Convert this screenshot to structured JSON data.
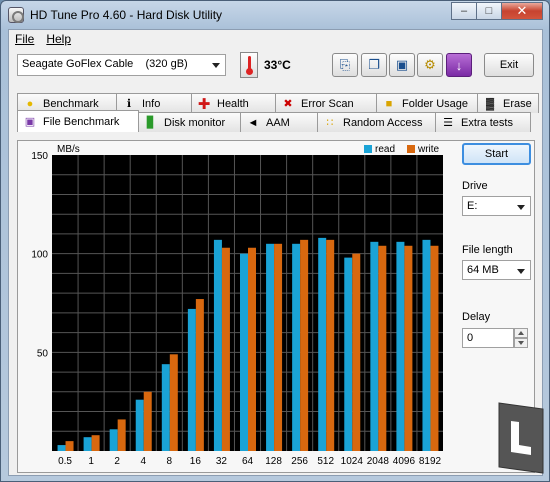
{
  "window": {
    "title": "HD Tune Pro 4.60 - Hard Disk Utility"
  },
  "menu": [
    {
      "label": "File"
    },
    {
      "label": "Help"
    }
  ],
  "toolbar": {
    "drive_selected": "Seagate GoFlex Cable    (320 gB)",
    "temperature": "33°C",
    "exit_label": "Exit"
  },
  "tabs_top": [
    {
      "label": "Benchmark",
      "icon": "lightbulb-icon"
    },
    {
      "label": "Info",
      "icon": "info-icon"
    },
    {
      "label": "Health",
      "icon": "health-cross-icon"
    },
    {
      "label": "Error Scan",
      "icon": "error-scan-icon"
    },
    {
      "label": "Folder Usage",
      "icon": "folder-icon"
    },
    {
      "label": "Erase",
      "icon": "trash-icon"
    }
  ],
  "tabs_bottom": [
    {
      "label": "File Benchmark",
      "icon": "file-benchmark-icon",
      "active": true
    },
    {
      "label": "Disk monitor",
      "icon": "disk-monitor-icon"
    },
    {
      "label": "AAM",
      "icon": "speaker-icon"
    },
    {
      "label": "Random Access",
      "icon": "random-access-icon"
    },
    {
      "label": "Extra tests",
      "icon": "extra-tests-icon"
    }
  ],
  "side": {
    "start_label": "Start",
    "drive_label": "Drive",
    "drive_value": "E:",
    "file_length_label": "File length",
    "file_length_value": "64 MB",
    "delay_label": "Delay",
    "delay_value": "0"
  },
  "colors": {
    "read": "#1aa3d6",
    "write": "#d8680f",
    "grid": "#555555",
    "plot_bg": "#000000"
  },
  "chart_data": {
    "type": "bar",
    "ylabel": "MB/s",
    "ylim": [
      0,
      150
    ],
    "yticks": [
      "50",
      "100",
      "150"
    ],
    "grid": true,
    "legend": "top-right",
    "categories": [
      "0.5",
      "1",
      "2",
      "4",
      "8",
      "16",
      "32",
      "64",
      "128",
      "256",
      "512",
      "1024",
      "2048",
      "4096",
      "8192"
    ],
    "series": [
      {
        "name": "read",
        "values": [
          3,
          7,
          11,
          26,
          44,
          72,
          107,
          100,
          105,
          105,
          108,
          98,
          106,
          106,
          107
        ]
      },
      {
        "name": "write",
        "values": [
          5,
          8,
          16,
          30,
          49,
          77,
          103,
          103,
          105,
          107,
          107,
          100,
          104,
          104,
          104
        ]
      }
    ]
  }
}
